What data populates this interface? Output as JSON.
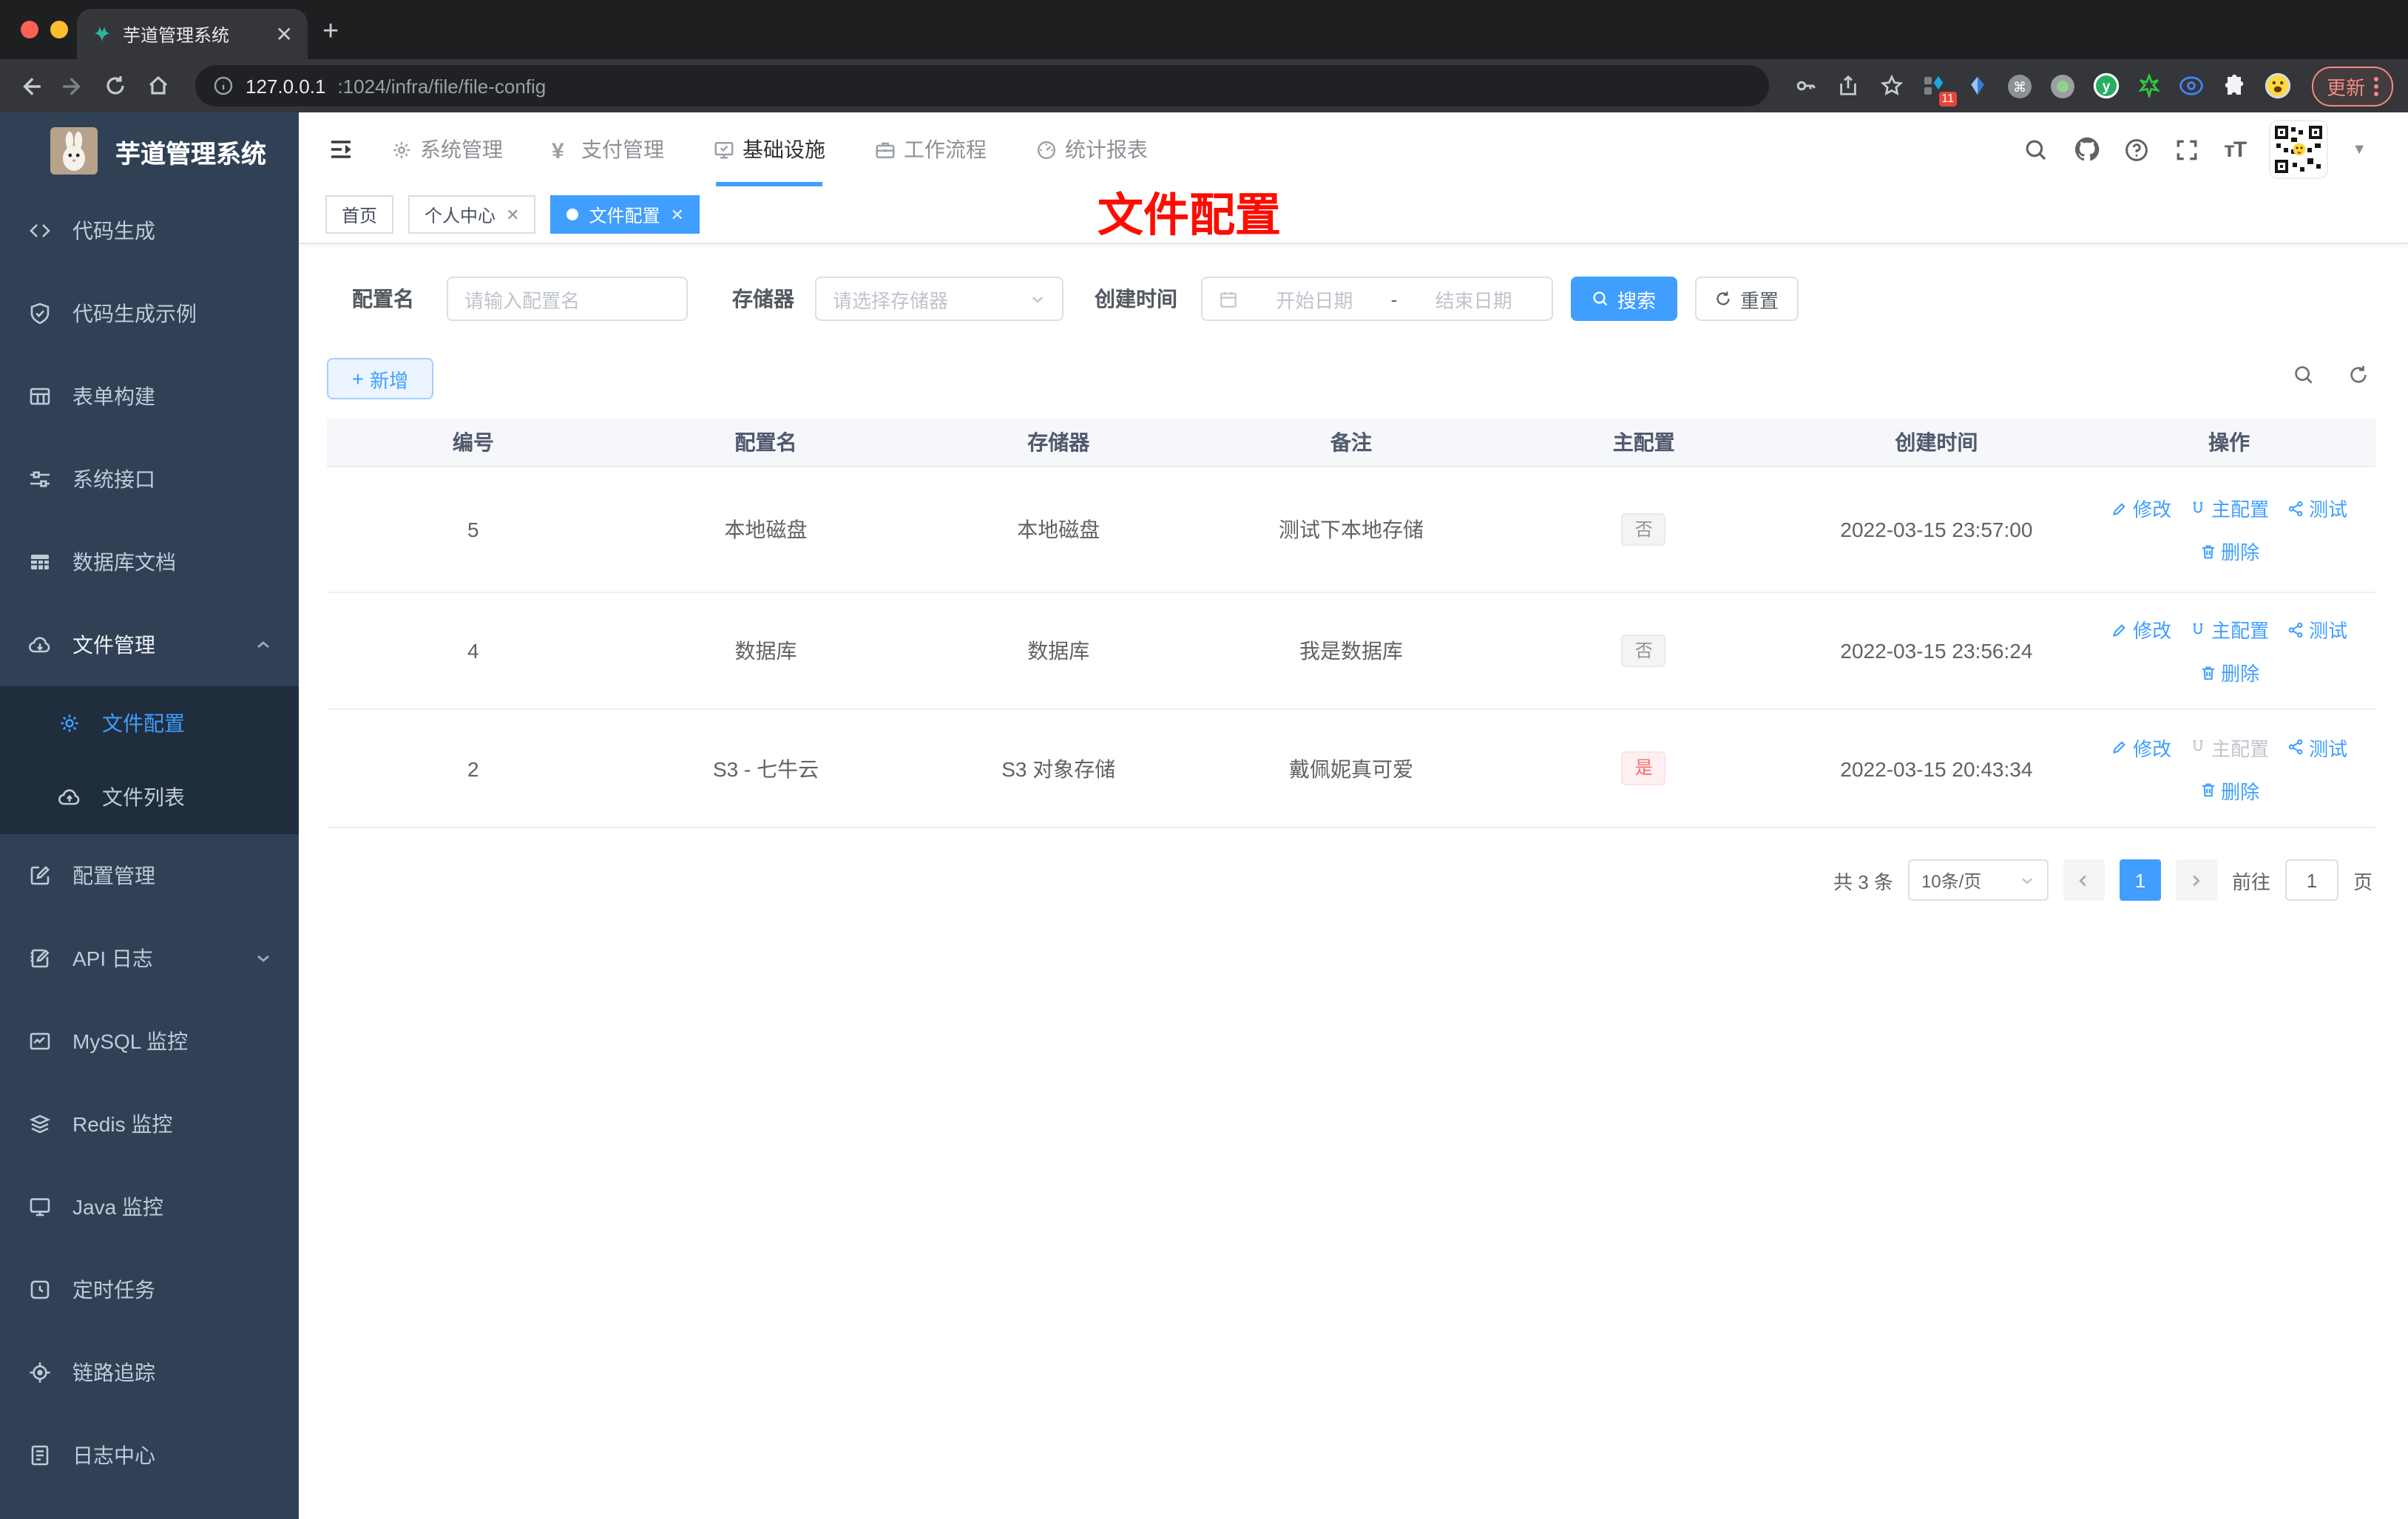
{
  "browser": {
    "tab_title": "芋道管理系统",
    "new_tab_label": "+",
    "url_host": "127.0.0.1",
    "url_path": ":1024/infra/file/file-config",
    "extensions_badge": "11",
    "update_label": "更新"
  },
  "sidebar": {
    "logo_title": "芋道管理系统",
    "items": [
      {
        "label": "代码生成",
        "icon": "code-icon"
      },
      {
        "label": "代码生成示例",
        "icon": "shield-check-icon"
      },
      {
        "label": "表单构建",
        "icon": "form-table-icon"
      },
      {
        "label": "系统接口",
        "icon": "sliders-icon"
      },
      {
        "label": "数据库文档",
        "icon": "table-filled-icon"
      },
      {
        "label": "文件管理",
        "icon": "cloud-download-icon",
        "expanded": true
      },
      {
        "label": "文件配置",
        "icon": "gear-icon",
        "active": true,
        "submenu": true
      },
      {
        "label": "文件列表",
        "icon": "cloud-upload-icon",
        "submenu": true
      },
      {
        "label": "配置管理",
        "icon": "edit-square-icon"
      },
      {
        "label": "API 日志",
        "icon": "note-edit-icon",
        "collapsible": true
      },
      {
        "label": "MySQL 监控",
        "icon": "chart-box-icon"
      },
      {
        "label": "Redis 监控",
        "icon": "layers-icon"
      },
      {
        "label": "Java 监控",
        "icon": "display-icon"
      },
      {
        "label": "定时任务",
        "icon": "timer-icon"
      },
      {
        "label": "链路追踪",
        "icon": "target-icon"
      },
      {
        "label": "日志中心",
        "icon": "document-icon"
      }
    ]
  },
  "topnav": {
    "items": [
      {
        "label": "系统管理",
        "icon": "gear-icon"
      },
      {
        "label": "支付管理",
        "icon": "yen-icon"
      },
      {
        "label": "基础设施",
        "icon": "monitor-check-icon",
        "active": true
      },
      {
        "label": "工作流程",
        "icon": "briefcase-icon"
      },
      {
        "label": "统计报表",
        "icon": "dashboard-icon"
      }
    ]
  },
  "tags": [
    {
      "label": "首页"
    },
    {
      "label": "个人中心",
      "closable": true
    },
    {
      "label": "文件配置",
      "closable": true,
      "active": true
    }
  ],
  "annotation": "文件配置",
  "filters": {
    "name_label": "配置名",
    "name_placeholder": "请输入配置名",
    "storage_label": "存储器",
    "storage_placeholder": "请选择存储器",
    "date_label": "创建时间",
    "date_start_placeholder": "开始日期",
    "date_separator": "-",
    "date_end_placeholder": "结束日期",
    "search_label": "搜索",
    "reset_label": "重置"
  },
  "toolbar": {
    "add_label": "新增"
  },
  "table": {
    "headers": [
      "编号",
      "配置名",
      "存储器",
      "备注",
      "主配置",
      "创建时间",
      "操作"
    ],
    "actions": {
      "edit": "修改",
      "master": "主配置",
      "test": "测试",
      "delete": "删除"
    },
    "rows": [
      {
        "id": "5",
        "name": "本地磁盘",
        "storage": "本地磁盘",
        "remark": "测试下本地存储",
        "master": "否",
        "master_type": "info",
        "created": "2022-03-15 23:57:00",
        "master_action_disabled": false
      },
      {
        "id": "4",
        "name": "数据库",
        "storage": "数据库",
        "remark": "我是数据库",
        "master": "否",
        "master_type": "info",
        "created": "2022-03-15 23:56:24",
        "master_action_disabled": false
      },
      {
        "id": "2",
        "name": "S3 - 七牛云",
        "storage": "S3 对象存储",
        "remark": "戴佩妮真可爱",
        "master": "是",
        "master_type": "danger",
        "created": "2022-03-15 20:43:34",
        "master_action_disabled": true
      }
    ]
  },
  "pagination": {
    "total_label": "共 3 条",
    "page_size_label": "10条/页",
    "current_page": "1",
    "goto_label": "前往",
    "goto_value": "1",
    "page_unit": "页"
  },
  "colors": {
    "accent": "#409eff",
    "sidebar_bg": "#304156",
    "submenu_bg": "#1f2d3d",
    "tag_info_text": "#909399",
    "tag_danger_text": "#f56c6c",
    "annotation_red": "#fd0d00"
  }
}
